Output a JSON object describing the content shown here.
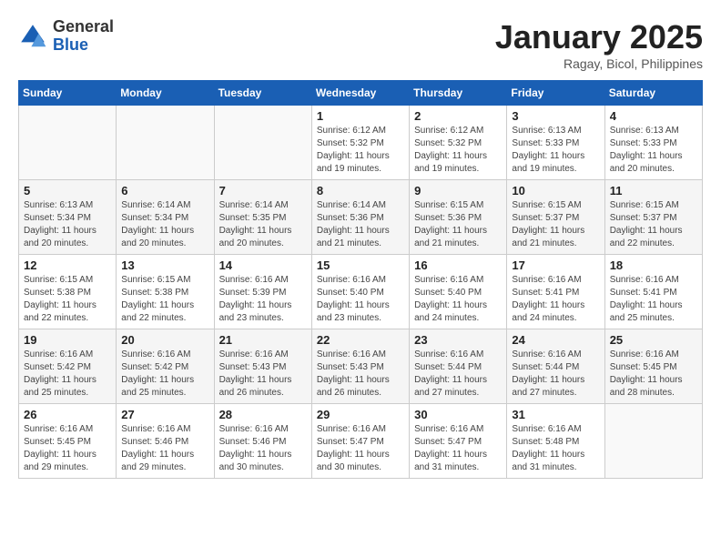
{
  "header": {
    "logo_general": "General",
    "logo_blue": "Blue",
    "month": "January 2025",
    "location": "Ragay, Bicol, Philippines"
  },
  "weekdays": [
    "Sunday",
    "Monday",
    "Tuesday",
    "Wednesday",
    "Thursday",
    "Friday",
    "Saturday"
  ],
  "weeks": [
    [
      {
        "day": "",
        "info": ""
      },
      {
        "day": "",
        "info": ""
      },
      {
        "day": "",
        "info": ""
      },
      {
        "day": "1",
        "info": "Sunrise: 6:12 AM\nSunset: 5:32 PM\nDaylight: 11 hours\nand 19 minutes."
      },
      {
        "day": "2",
        "info": "Sunrise: 6:12 AM\nSunset: 5:32 PM\nDaylight: 11 hours\nand 19 minutes."
      },
      {
        "day": "3",
        "info": "Sunrise: 6:13 AM\nSunset: 5:33 PM\nDaylight: 11 hours\nand 19 minutes."
      },
      {
        "day": "4",
        "info": "Sunrise: 6:13 AM\nSunset: 5:33 PM\nDaylight: 11 hours\nand 20 minutes."
      }
    ],
    [
      {
        "day": "5",
        "info": "Sunrise: 6:13 AM\nSunset: 5:34 PM\nDaylight: 11 hours\nand 20 minutes."
      },
      {
        "day": "6",
        "info": "Sunrise: 6:14 AM\nSunset: 5:34 PM\nDaylight: 11 hours\nand 20 minutes."
      },
      {
        "day": "7",
        "info": "Sunrise: 6:14 AM\nSunset: 5:35 PM\nDaylight: 11 hours\nand 20 minutes."
      },
      {
        "day": "8",
        "info": "Sunrise: 6:14 AM\nSunset: 5:36 PM\nDaylight: 11 hours\nand 21 minutes."
      },
      {
        "day": "9",
        "info": "Sunrise: 6:15 AM\nSunset: 5:36 PM\nDaylight: 11 hours\nand 21 minutes."
      },
      {
        "day": "10",
        "info": "Sunrise: 6:15 AM\nSunset: 5:37 PM\nDaylight: 11 hours\nand 21 minutes."
      },
      {
        "day": "11",
        "info": "Sunrise: 6:15 AM\nSunset: 5:37 PM\nDaylight: 11 hours\nand 22 minutes."
      }
    ],
    [
      {
        "day": "12",
        "info": "Sunrise: 6:15 AM\nSunset: 5:38 PM\nDaylight: 11 hours\nand 22 minutes."
      },
      {
        "day": "13",
        "info": "Sunrise: 6:15 AM\nSunset: 5:38 PM\nDaylight: 11 hours\nand 22 minutes."
      },
      {
        "day": "14",
        "info": "Sunrise: 6:16 AM\nSunset: 5:39 PM\nDaylight: 11 hours\nand 23 minutes."
      },
      {
        "day": "15",
        "info": "Sunrise: 6:16 AM\nSunset: 5:40 PM\nDaylight: 11 hours\nand 23 minutes."
      },
      {
        "day": "16",
        "info": "Sunrise: 6:16 AM\nSunset: 5:40 PM\nDaylight: 11 hours\nand 24 minutes."
      },
      {
        "day": "17",
        "info": "Sunrise: 6:16 AM\nSunset: 5:41 PM\nDaylight: 11 hours\nand 24 minutes."
      },
      {
        "day": "18",
        "info": "Sunrise: 6:16 AM\nSunset: 5:41 PM\nDaylight: 11 hours\nand 25 minutes."
      }
    ],
    [
      {
        "day": "19",
        "info": "Sunrise: 6:16 AM\nSunset: 5:42 PM\nDaylight: 11 hours\nand 25 minutes."
      },
      {
        "day": "20",
        "info": "Sunrise: 6:16 AM\nSunset: 5:42 PM\nDaylight: 11 hours\nand 25 minutes."
      },
      {
        "day": "21",
        "info": "Sunrise: 6:16 AM\nSunset: 5:43 PM\nDaylight: 11 hours\nand 26 minutes."
      },
      {
        "day": "22",
        "info": "Sunrise: 6:16 AM\nSunset: 5:43 PM\nDaylight: 11 hours\nand 26 minutes."
      },
      {
        "day": "23",
        "info": "Sunrise: 6:16 AM\nSunset: 5:44 PM\nDaylight: 11 hours\nand 27 minutes."
      },
      {
        "day": "24",
        "info": "Sunrise: 6:16 AM\nSunset: 5:44 PM\nDaylight: 11 hours\nand 27 minutes."
      },
      {
        "day": "25",
        "info": "Sunrise: 6:16 AM\nSunset: 5:45 PM\nDaylight: 11 hours\nand 28 minutes."
      }
    ],
    [
      {
        "day": "26",
        "info": "Sunrise: 6:16 AM\nSunset: 5:45 PM\nDaylight: 11 hours\nand 29 minutes."
      },
      {
        "day": "27",
        "info": "Sunrise: 6:16 AM\nSunset: 5:46 PM\nDaylight: 11 hours\nand 29 minutes."
      },
      {
        "day": "28",
        "info": "Sunrise: 6:16 AM\nSunset: 5:46 PM\nDaylight: 11 hours\nand 30 minutes."
      },
      {
        "day": "29",
        "info": "Sunrise: 6:16 AM\nSunset: 5:47 PM\nDaylight: 11 hours\nand 30 minutes."
      },
      {
        "day": "30",
        "info": "Sunrise: 6:16 AM\nSunset: 5:47 PM\nDaylight: 11 hours\nand 31 minutes."
      },
      {
        "day": "31",
        "info": "Sunrise: 6:16 AM\nSunset: 5:48 PM\nDaylight: 11 hours\nand 31 minutes."
      },
      {
        "day": "",
        "info": ""
      }
    ]
  ]
}
